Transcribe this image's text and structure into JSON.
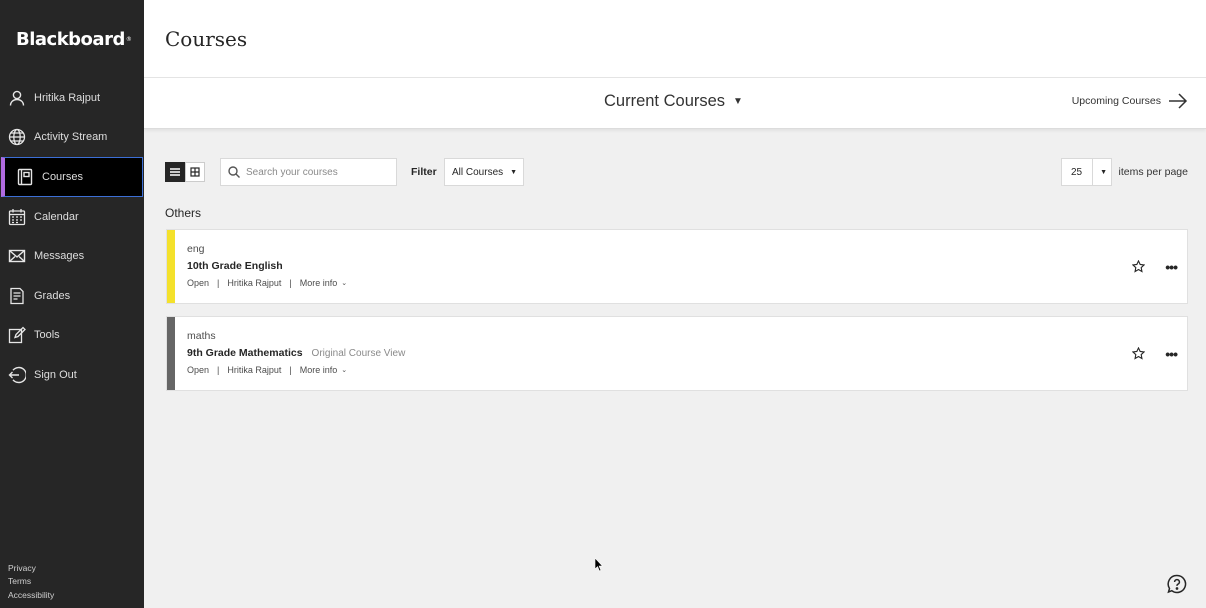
{
  "brand": {
    "logo_text": "Blackboard"
  },
  "sidebar": {
    "items": [
      {
        "label": "Hritika Rajput",
        "icon": "user-icon",
        "active": false
      },
      {
        "label": "Activity Stream",
        "icon": "globe-icon",
        "active": false
      },
      {
        "label": "Courses",
        "icon": "courses-icon",
        "active": true
      },
      {
        "label": "Calendar",
        "icon": "calendar-icon",
        "active": false
      },
      {
        "label": "Messages",
        "icon": "envelope-icon",
        "active": false
      },
      {
        "label": "Grades",
        "icon": "grades-icon",
        "active": false
      },
      {
        "label": "Tools",
        "icon": "tools-icon",
        "active": false
      },
      {
        "label": "Sign Out",
        "icon": "sign-out-icon",
        "active": false
      }
    ],
    "legal": {
      "privacy": "Privacy",
      "terms": "Terms",
      "accessibility": "Accessibility"
    }
  },
  "header": {
    "title": "Courses"
  },
  "courses_bar": {
    "current_label": "Current Courses",
    "upcoming_label": "Upcoming Courses"
  },
  "toolbar": {
    "search_placeholder": "Search your courses",
    "filter_label": "Filter",
    "filter_value": "All Courses",
    "per_page_value": "25",
    "per_page_label": "items per page"
  },
  "section": {
    "label": "Others"
  },
  "courses": [
    {
      "code": "eng",
      "name": "10th Grade English",
      "view": "",
      "status": "Open",
      "instructor": "Hritika Rajput",
      "more": "More info",
      "color": "#f4e12b"
    },
    {
      "code": "maths",
      "name": "9th Grade Mathematics",
      "view": "Original Course View",
      "status": "Open",
      "instructor": "Hritika Rajput",
      "more": "More info",
      "color": "#666666"
    }
  ],
  "colors": {
    "sidebar_bg": "#262626",
    "active_border_left": "#b06be0",
    "active_border": "#3c6fd6"
  }
}
